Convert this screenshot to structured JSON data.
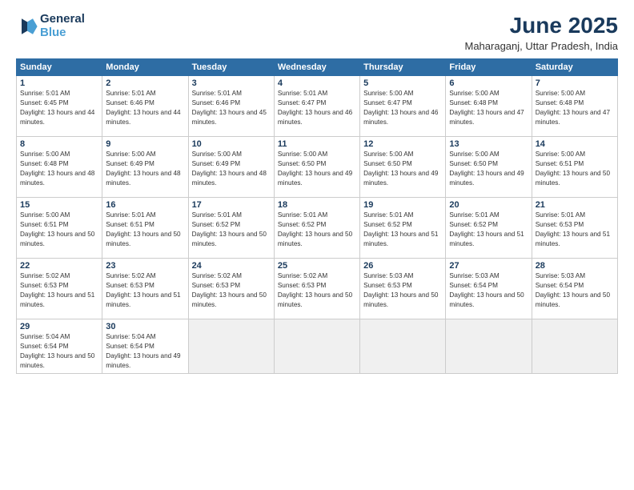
{
  "header": {
    "logo_line1": "General",
    "logo_line2": "Blue",
    "month": "June 2025",
    "location": "Maharaganj, Uttar Pradesh, India"
  },
  "weekdays": [
    "Sunday",
    "Monday",
    "Tuesday",
    "Wednesday",
    "Thursday",
    "Friday",
    "Saturday"
  ],
  "weeks": [
    [
      {
        "day": 1,
        "sunrise": "5:01 AM",
        "sunset": "6:45 PM",
        "daylight": "13 hours and 44 minutes."
      },
      {
        "day": 2,
        "sunrise": "5:01 AM",
        "sunset": "6:46 PM",
        "daylight": "13 hours and 44 minutes."
      },
      {
        "day": 3,
        "sunrise": "5:01 AM",
        "sunset": "6:46 PM",
        "daylight": "13 hours and 45 minutes."
      },
      {
        "day": 4,
        "sunrise": "5:01 AM",
        "sunset": "6:47 PM",
        "daylight": "13 hours and 46 minutes."
      },
      {
        "day": 5,
        "sunrise": "5:00 AM",
        "sunset": "6:47 PM",
        "daylight": "13 hours and 46 minutes."
      },
      {
        "day": 6,
        "sunrise": "5:00 AM",
        "sunset": "6:48 PM",
        "daylight": "13 hours and 47 minutes."
      },
      {
        "day": 7,
        "sunrise": "5:00 AM",
        "sunset": "6:48 PM",
        "daylight": "13 hours and 47 minutes."
      }
    ],
    [
      {
        "day": 8,
        "sunrise": "5:00 AM",
        "sunset": "6:48 PM",
        "daylight": "13 hours and 48 minutes."
      },
      {
        "day": 9,
        "sunrise": "5:00 AM",
        "sunset": "6:49 PM",
        "daylight": "13 hours and 48 minutes."
      },
      {
        "day": 10,
        "sunrise": "5:00 AM",
        "sunset": "6:49 PM",
        "daylight": "13 hours and 48 minutes."
      },
      {
        "day": 11,
        "sunrise": "5:00 AM",
        "sunset": "6:50 PM",
        "daylight": "13 hours and 49 minutes."
      },
      {
        "day": 12,
        "sunrise": "5:00 AM",
        "sunset": "6:50 PM",
        "daylight": "13 hours and 49 minutes."
      },
      {
        "day": 13,
        "sunrise": "5:00 AM",
        "sunset": "6:50 PM",
        "daylight": "13 hours and 49 minutes."
      },
      {
        "day": 14,
        "sunrise": "5:00 AM",
        "sunset": "6:51 PM",
        "daylight": "13 hours and 50 minutes."
      }
    ],
    [
      {
        "day": 15,
        "sunrise": "5:00 AM",
        "sunset": "6:51 PM",
        "daylight": "13 hours and 50 minutes."
      },
      {
        "day": 16,
        "sunrise": "5:01 AM",
        "sunset": "6:51 PM",
        "daylight": "13 hours and 50 minutes."
      },
      {
        "day": 17,
        "sunrise": "5:01 AM",
        "sunset": "6:52 PM",
        "daylight": "13 hours and 50 minutes."
      },
      {
        "day": 18,
        "sunrise": "5:01 AM",
        "sunset": "6:52 PM",
        "daylight": "13 hours and 50 minutes."
      },
      {
        "day": 19,
        "sunrise": "5:01 AM",
        "sunset": "6:52 PM",
        "daylight": "13 hours and 51 minutes."
      },
      {
        "day": 20,
        "sunrise": "5:01 AM",
        "sunset": "6:52 PM",
        "daylight": "13 hours and 51 minutes."
      },
      {
        "day": 21,
        "sunrise": "5:01 AM",
        "sunset": "6:53 PM",
        "daylight": "13 hours and 51 minutes."
      }
    ],
    [
      {
        "day": 22,
        "sunrise": "5:02 AM",
        "sunset": "6:53 PM",
        "daylight": "13 hours and 51 minutes."
      },
      {
        "day": 23,
        "sunrise": "5:02 AM",
        "sunset": "6:53 PM",
        "daylight": "13 hours and 51 minutes."
      },
      {
        "day": 24,
        "sunrise": "5:02 AM",
        "sunset": "6:53 PM",
        "daylight": "13 hours and 50 minutes."
      },
      {
        "day": 25,
        "sunrise": "5:02 AM",
        "sunset": "6:53 PM",
        "daylight": "13 hours and 50 minutes."
      },
      {
        "day": 26,
        "sunrise": "5:03 AM",
        "sunset": "6:53 PM",
        "daylight": "13 hours and 50 minutes."
      },
      {
        "day": 27,
        "sunrise": "5:03 AM",
        "sunset": "6:54 PM",
        "daylight": "13 hours and 50 minutes."
      },
      {
        "day": 28,
        "sunrise": "5:03 AM",
        "sunset": "6:54 PM",
        "daylight": "13 hours and 50 minutes."
      }
    ],
    [
      {
        "day": 29,
        "sunrise": "5:04 AM",
        "sunset": "6:54 PM",
        "daylight": "13 hours and 50 minutes."
      },
      {
        "day": 30,
        "sunrise": "5:04 AM",
        "sunset": "6:54 PM",
        "daylight": "13 hours and 49 minutes."
      },
      null,
      null,
      null,
      null,
      null
    ]
  ]
}
